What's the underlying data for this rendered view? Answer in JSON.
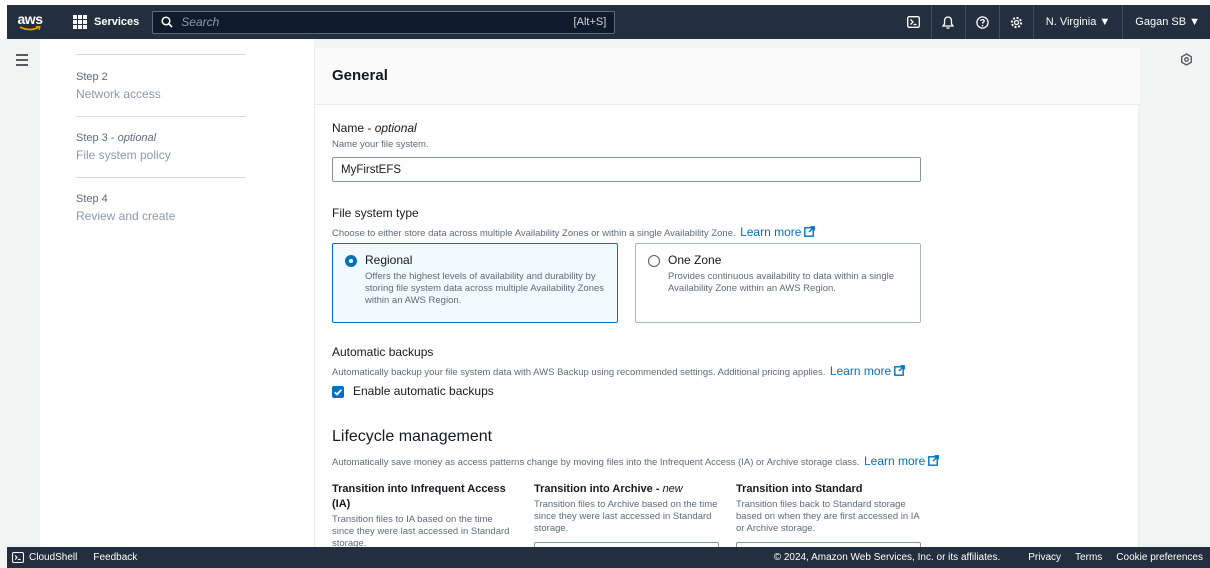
{
  "nav": {
    "logo_text": "aws",
    "services_label": "Services",
    "search_placeholder": "Search",
    "search_shortcut": "[Alt+S]",
    "region": "N. Virginia ▼",
    "user": "Gagan SB ▼"
  },
  "steps": [
    {
      "step": "Step 2",
      "optional": "",
      "title": "Network access"
    },
    {
      "step": "Step 3 - ",
      "optional": "optional",
      "title": "File system policy"
    },
    {
      "step": "Step 4",
      "optional": "",
      "title": "Review and create"
    }
  ],
  "general": {
    "title": "General",
    "name_label": "Name - ",
    "name_optional": "optional",
    "name_desc": "Name your file system.",
    "name_value": "MyFirstEFS",
    "fs_type_label": "File system type",
    "fs_type_desc": "Choose to either store data across multiple Availability Zones or within a single Availability Zone.",
    "learn_more": "Learn more",
    "regional_title": "Regional",
    "regional_desc": "Offers the highest levels of availability and durability by storing file system data across multiple Availability Zones within an AWS Region.",
    "onezone_title": "One Zone",
    "onezone_desc": "Provides continuous availability to data within a single Availability Zone within an AWS Region.",
    "backup_label": "Automatic backups",
    "backup_desc": "Automatically backup your file system data with AWS Backup using recommended settings. Additional pricing applies.",
    "backup_checkbox": "Enable automatic backups"
  },
  "lifecycle": {
    "title": "Lifecycle management",
    "desc": "Automatically save money as access patterns change by moving files into the Infrequent Access (IA) or Archive storage class.",
    "ia_title": "Transition into Infrequent Access (IA)",
    "ia_desc": "Transition files to IA based on the time since they were last accessed in Standard storage.",
    "archive_title": "Transition into Archive - ",
    "archive_new": "new",
    "archive_desc": "Transition files to Archive based on the time since they were last accessed in Standard storage.",
    "standard_title": "Transition into Standard",
    "standard_desc": "Transition files back to Standard storage based on when they are first accessed in IA or Archive storage."
  },
  "footer": {
    "cloudshell": "CloudShell",
    "feedback": "Feedback",
    "copyright": "© 2024, Amazon Web Services, Inc. or its affiliates.",
    "privacy": "Privacy",
    "terms": "Terms",
    "cookie": "Cookie preferences"
  },
  "colors": {
    "nav_bg": "#232f3e",
    "accent": "#0073bb",
    "selected_tile_bg": "#f1faff"
  }
}
